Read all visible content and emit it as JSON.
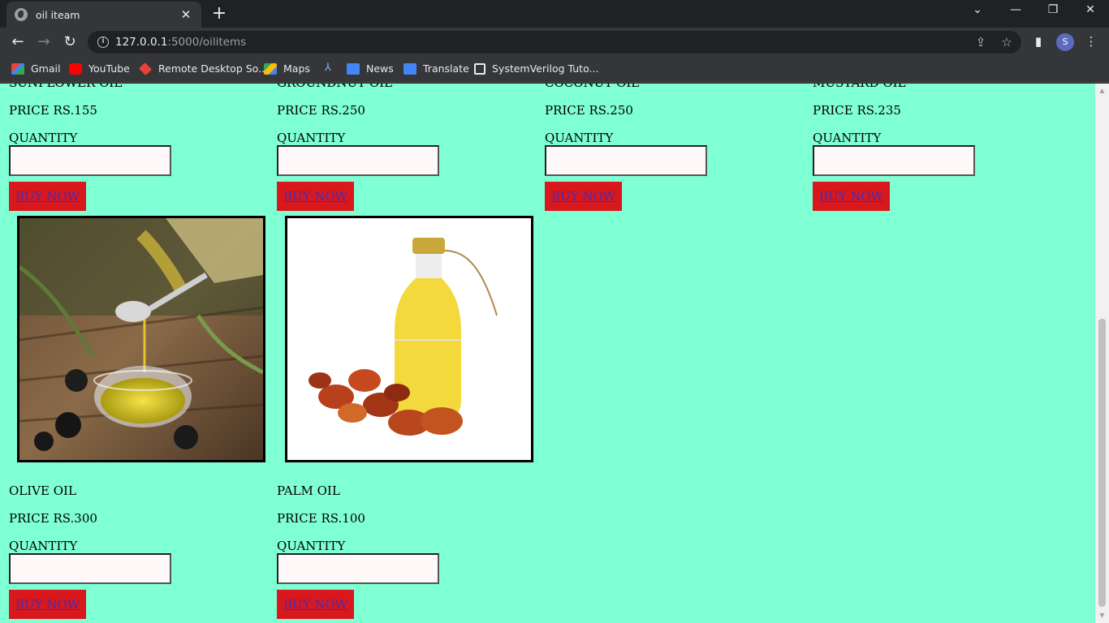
{
  "browser": {
    "tab_title": "oil iteam",
    "url_host": "127.0.0.1",
    "url_rest": ":5000/oilitems",
    "profile_initial": "S",
    "bookmarks": [
      "Gmail",
      "YouTube",
      "Remote Desktop So...",
      "Maps",
      "News",
      "Translate",
      "SystemVerilog Tuto..."
    ]
  },
  "products_top": [
    {
      "name": "SUNFLOWER OIL",
      "price": "PRICE RS.155",
      "qty_label": "QUANTITY",
      "buy_label": "BUY NOW"
    },
    {
      "name": "GROUNDNUT OIL",
      "price": "PRICE RS.250",
      "qty_label": "QUANTITY",
      "buy_label": "BUY NOW"
    },
    {
      "name": "COCONUT OIL",
      "price": "PRICE RS.250",
      "qty_label": "QUANTITY",
      "buy_label": "BUY NOW"
    },
    {
      "name": "MUSTARD OIL",
      "price": "PRICE RS.235",
      "qty_label": "QUANTITY",
      "buy_label": "BUY NOW"
    }
  ],
  "products_bottom": [
    {
      "name": "OLIVE OIL",
      "price": "PRICE RS.300",
      "qty_label": "QUANTITY",
      "buy_label": "BUY NOW",
      "image": "olive-oil-pouring-photo"
    },
    {
      "name": "PALM OIL",
      "price": "PRICE RS.100",
      "qty_label": "QUANTITY",
      "buy_label": "BUY NOW",
      "image": "palm-oil-bottle-photo"
    }
  ]
}
